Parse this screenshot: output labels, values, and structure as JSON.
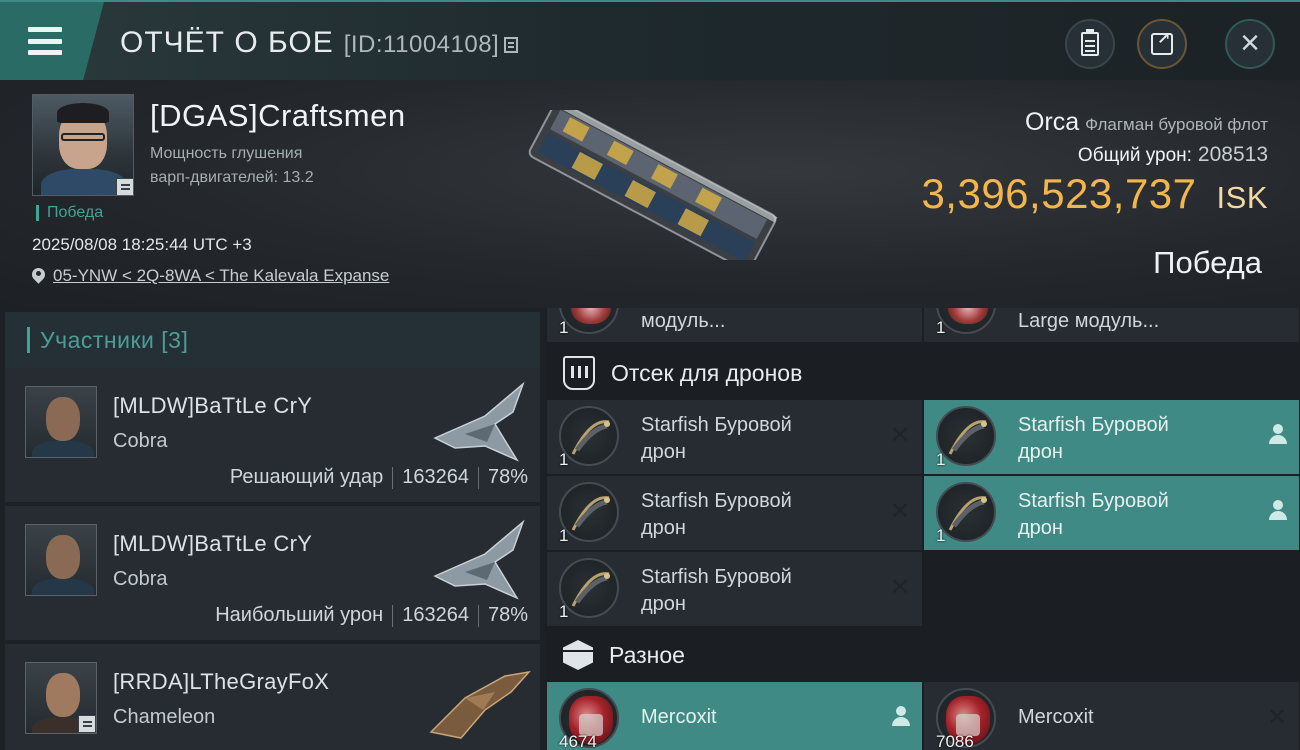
{
  "header": {
    "title": "ОТЧЁТ О БОЕ",
    "id_text": "[ID:11004108]"
  },
  "victim": {
    "name": "[DGAS]Craftsmen",
    "warp_line1": "Мощность глушения",
    "warp_line2": "варп-двигателей: 13.2",
    "status": "Победа",
    "datetime": "2025/08/08 18:25:44 UTC +3",
    "location": "05-YNW < 2Q-8WA < The Kalevala Expanse",
    "ship": "Orca",
    "ship_class": "Флагман буровой флот",
    "total_damage_label": "Общий урон:",
    "total_damage": "208513",
    "isk_value": "3,396,523,737",
    "isk_unit": "ISK",
    "result": "Победа"
  },
  "participants": {
    "title": "Участники [3]",
    "items": [
      {
        "name": "[MLDW]BaTtLe CrY",
        "ship": "Cobra",
        "role": "Решающий удар",
        "damage": "163264",
        "percent": "78%"
      },
      {
        "name": "[MLDW]BaTtLe CrY",
        "ship": "Cobra",
        "role": "Наибольший урон",
        "damage": "163264",
        "percent": "78%"
      },
      {
        "name": "[RRDA]LTheGrayFoX",
        "ship": "Chameleon"
      }
    ]
  },
  "loot": {
    "top_row": [
      {
        "qty": "1",
        "label": "модуль...",
        "state": "destroyed"
      },
      {
        "qty": "1",
        "label": "Large модуль...",
        "state": "destroyed"
      }
    ],
    "drone_bay_title": "Отсек для дронов",
    "drones": [
      {
        "qty": "1",
        "line1": "Starfish Буровой",
        "line2": "дрон",
        "state": "destroyed"
      },
      {
        "qty": "1",
        "line1": "Starfish Буровой",
        "line2": "дрон",
        "state": "dropped"
      },
      {
        "qty": "1",
        "line1": "Starfish Буровой",
        "line2": "дрон",
        "state": "destroyed"
      },
      {
        "qty": "1",
        "line1": "Starfish Буровой",
        "line2": "дрон",
        "state": "dropped"
      },
      {
        "qty": "1",
        "line1": "Starfish Буровой",
        "line2": "дрон",
        "state": "destroyed"
      }
    ],
    "misc_title": "Разное",
    "misc": [
      {
        "qty": "4674",
        "label": "Mercoxit",
        "state": "dropped"
      },
      {
        "qty": "7086",
        "label": "Mercoxit",
        "state": "destroyed"
      }
    ]
  },
  "colors": {
    "accent": "#3f8a84",
    "isk": "#f2b64c",
    "victory": "#3fa595"
  },
  "icons": {
    "menu": "hamburger-icon",
    "copy": "copy-icon",
    "report": "clipboard-icon",
    "share": "share-icon",
    "close": "close-icon",
    "location": "map-pin-icon",
    "drone_bay": "drone-bay-icon",
    "misc": "cube-icon",
    "destroyed": "x-icon",
    "dropped": "person-icon"
  }
}
